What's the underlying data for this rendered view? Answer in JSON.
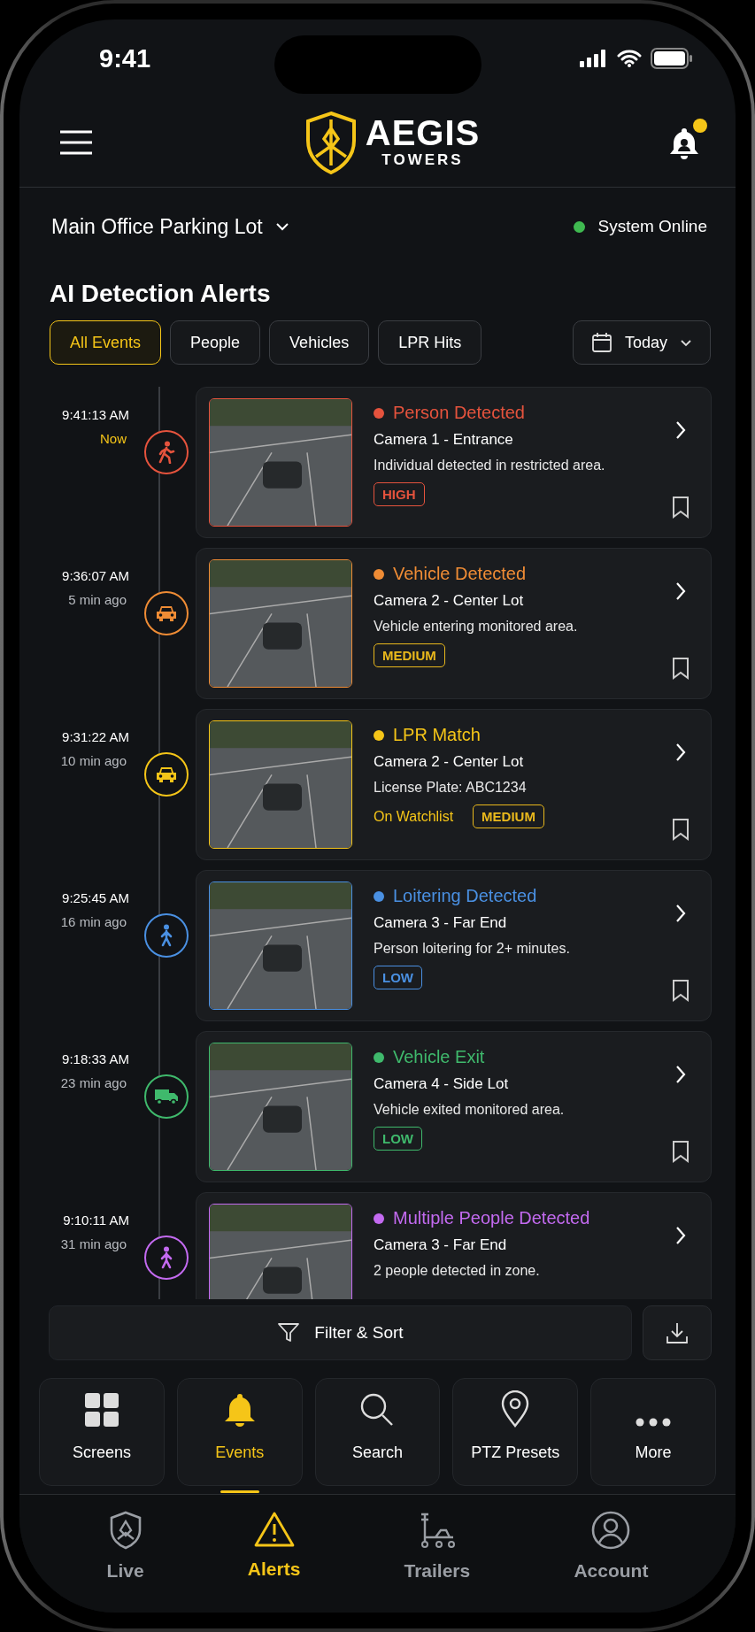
{
  "status_bar": {
    "time": "9:41"
  },
  "header": {
    "brand": "AEGIS",
    "brand_sub": "TOWERS",
    "has_notification": true
  },
  "location": {
    "name": "Main Office Parking Lot",
    "status": "System Online",
    "online": true
  },
  "title": "AI Detection Alerts",
  "filters": [
    {
      "label": "All Events",
      "selected": true
    },
    {
      "label": "People",
      "selected": false
    },
    {
      "label": "Vehicles",
      "selected": false
    },
    {
      "label": "LPR Hits",
      "selected": false
    }
  ],
  "date_filter": {
    "label": "Today"
  },
  "events": [
    {
      "time": "9:41:13 AM",
      "ago": "Now",
      "recent": true,
      "kind": "run",
      "color": "#e5533d",
      "title": "Person Detected",
      "camera": "Camera 1 - Entrance",
      "description": "Individual detected in restricted area.",
      "severity": {
        "label": "HIGH",
        "color": "#e5533d"
      }
    },
    {
      "time": "9:36:07 AM",
      "ago": "5 min ago",
      "recent": false,
      "kind": "car",
      "color": "#ef8c35",
      "title": "Vehicle Detected",
      "camera": "Camera 2 - Center Lot",
      "description": "Vehicle entering monitored area.",
      "severity": {
        "label": "MEDIUM",
        "color": "#e9b81c"
      }
    },
    {
      "time": "9:31:22 AM",
      "ago": "10 min ago",
      "recent": false,
      "kind": "car",
      "color": "#f5c518",
      "title": "LPR Match",
      "camera": "Camera 2 - Center Lot",
      "description": "License Plate: ABC1234",
      "tag": "On Watchlist",
      "severity": {
        "label": "MEDIUM",
        "color": "#e9b81c"
      }
    },
    {
      "time": "9:25:45 AM",
      "ago": "16 min ago",
      "recent": false,
      "kind": "walk",
      "color": "#4a90e2",
      "title": "Loitering Detected",
      "camera": "Camera 3 - Far End",
      "description": "Person loitering for 2+ minutes.",
      "severity": {
        "label": "LOW",
        "color": "#4a90e2"
      }
    },
    {
      "time": "9:18:33 AM",
      "ago": "23 min ago",
      "recent": false,
      "kind": "truck",
      "color": "#3fb96c",
      "title": "Vehicle Exit",
      "camera": "Camera 4 - Side Lot",
      "description": "Vehicle exited monitored area.",
      "severity": {
        "label": "LOW",
        "color": "#3fb96c"
      }
    },
    {
      "time": "9:10:11 AM",
      "ago": "31 min ago",
      "recent": false,
      "kind": "walk",
      "color": "#c36af0",
      "title": "Multiple People Detected",
      "camera": "Camera 3 - Far End",
      "description": "2 people detected in zone."
    }
  ],
  "filter_bar": {
    "label": "Filter & Sort"
  },
  "quick_tabs": [
    {
      "label": "Screens",
      "kind": "grid",
      "selected": false
    },
    {
      "label": "Events",
      "kind": "bell",
      "selected": true
    },
    {
      "label": "Search",
      "kind": "search",
      "selected": false
    },
    {
      "label": "PTZ Presets",
      "kind": "pin",
      "selected": false
    },
    {
      "label": "More",
      "kind": "dots",
      "selected": false
    }
  ],
  "nav": [
    {
      "label": "Live",
      "kind": "shield",
      "selected": false
    },
    {
      "label": "Alerts",
      "kind": "alert",
      "selected": true
    },
    {
      "label": "Trailers",
      "kind": "trailer",
      "selected": false
    },
    {
      "label": "Account",
      "kind": "account",
      "selected": false
    }
  ]
}
